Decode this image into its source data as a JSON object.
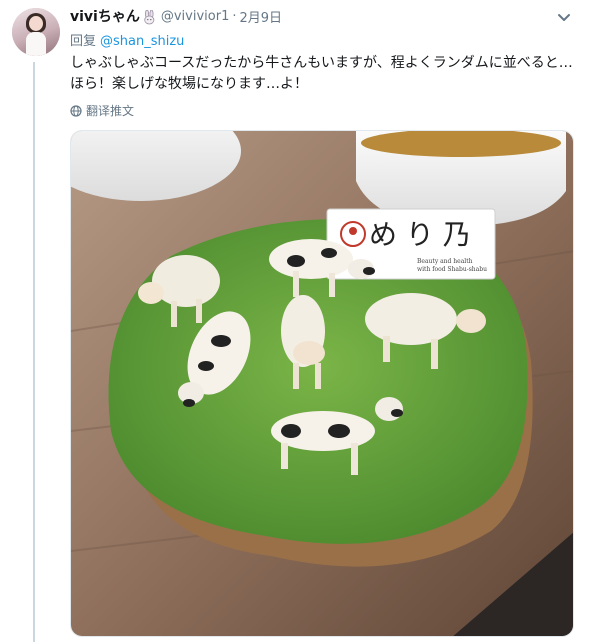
{
  "tweet": {
    "display_name": "viviちゃん",
    "handle": "@vivivior1",
    "separator": "·",
    "date": "2月9日",
    "reply_prefix": "回复",
    "reply_to": "@shan_shizu",
    "text_lines": [
      "しゃぶしゃぶコースだったから牛さんもいますが、程よくランダムに並べると…",
      "ほら！楽しげな牧場になります…よ！"
    ],
    "translate_label": "翻译推文",
    "media_sign": {
      "title": "め り 乃",
      "subtitle_1": "Beauty and health",
      "subtitle_2": "with food Shabu-shabu"
    }
  },
  "colors": {
    "link": "#1b95e0",
    "secondary_text": "#657786",
    "thread_line": "#ccd6dd",
    "grass": "#5e9a3a",
    "table": "#8a6b55"
  },
  "icons": [
    "rabbit-icon",
    "chevron-down-icon",
    "globe-icon"
  ]
}
